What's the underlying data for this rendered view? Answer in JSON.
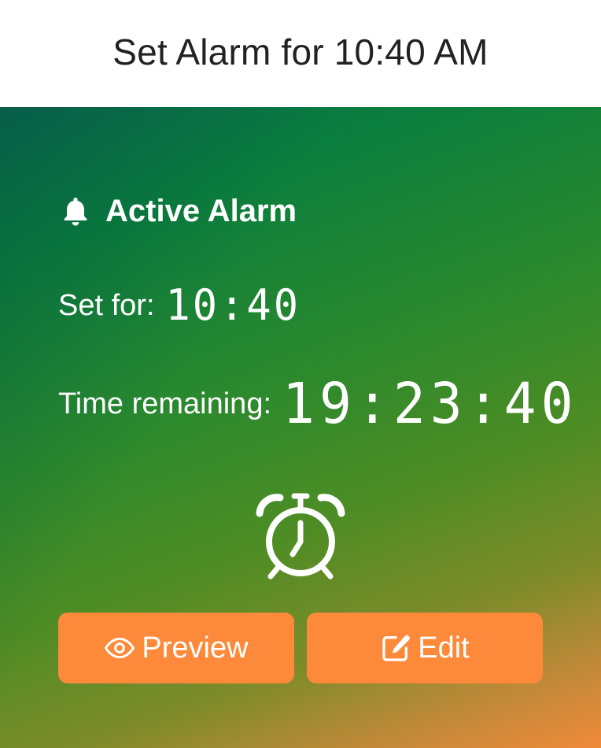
{
  "header": {
    "title": "Set Alarm for 10:40 AM"
  },
  "alarm_card": {
    "heading": "Active Alarm",
    "heading_icon": "bell-icon",
    "set_for_label": "Set for:",
    "set_for_time": "10:40",
    "remaining_label": "Time remaining:",
    "remaining_time": "19:23:40",
    "center_icon": "alarm-clock-icon"
  },
  "actions": {
    "preview_label": "Preview",
    "preview_icon": "eye-icon",
    "edit_label": "Edit",
    "edit_icon": "edit-icon"
  },
  "colors": {
    "button_bg": "#fd8a3a",
    "text": "#ffffff",
    "header_text": "#222222"
  }
}
